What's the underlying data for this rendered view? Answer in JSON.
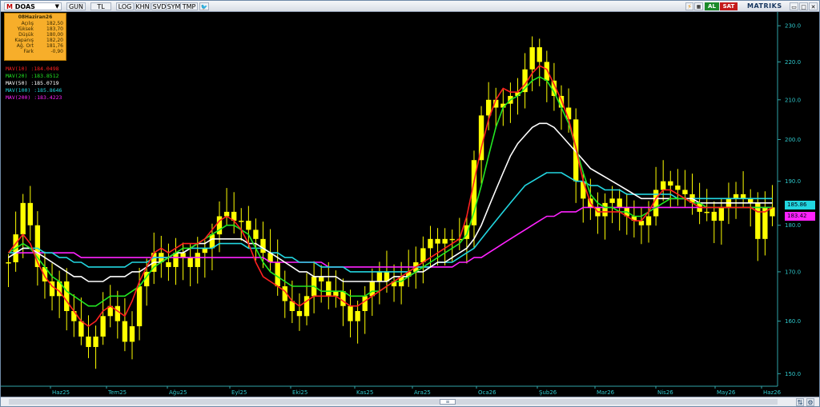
{
  "toolbar": {
    "symbol_prefix": "M",
    "symbol": "DOAS",
    "buttons": [
      "GUN",
      "TL",
      "LOG",
      "KHN",
      "SVD",
      "SYM",
      "TMP"
    ],
    "signal_buy": "AL",
    "signal_sell": "SAT",
    "brand": "MATRIKS"
  },
  "info": {
    "date": "08Haziran26",
    "rows": [
      {
        "label": "Açılış",
        "value": "182,50"
      },
      {
        "label": "Yüksek",
        "value": "183,70"
      },
      {
        "label": "Düşük",
        "value": "180,00"
      },
      {
        "label": "Kapanış",
        "value": "182,20"
      },
      {
        "label": "Ağ. Ort",
        "value": "181,76"
      },
      {
        "label": "Fark",
        "value": "-0,90"
      }
    ]
  },
  "legend": [
    {
      "name": "MAV(10)",
      "value": ":184.0498",
      "color": "#ff2020"
    },
    {
      "name": "MAV(20)",
      "value": ":183.8512",
      "color": "#22e622"
    },
    {
      "name": "MAV(50)",
      "value": ":185.0719",
      "color": "#ffffff"
    },
    {
      "name": "MAV(100)",
      "value": ":185.8646",
      "color": "#22d6e0"
    },
    {
      "name": "MAV(200)",
      "value": ":183.4223",
      "color": "#ff22ff"
    }
  ],
  "badges": [
    {
      "text": "185.86",
      "color": "#22d6e0"
    },
    {
      "text": "183.42",
      "color": "#ff22ff"
    }
  ],
  "chart_data": {
    "type": "candlestick",
    "x_ticks": [
      "Haz25",
      "Tem25",
      "Ağu25",
      "Eyl25",
      "Eki25",
      "Kas25",
      "Ara25",
      "Oca26",
      "Şub26",
      "Mar26",
      "Nis26",
      "May26",
      "Haz26"
    ],
    "y_ticks": [
      150,
      160,
      170,
      180,
      190,
      200,
      210,
      220,
      230
    ],
    "scale": "log",
    "ylim": [
      148,
      233
    ],
    "candle_color": "#ffff00",
    "closes": [
      172,
      178,
      185,
      180,
      171,
      168,
      165,
      168,
      162,
      160,
      157,
      155,
      157,
      161,
      163,
      160,
      156,
      159,
      167,
      170,
      174,
      172,
      171,
      174,
      173,
      171,
      174,
      175,
      178,
      182,
      183,
      181,
      181,
      179,
      177,
      174,
      172,
      167,
      164,
      162,
      161,
      165,
      169,
      168,
      165,
      166,
      163,
      160,
      162,
      165,
      168,
      170,
      168,
      167,
      169,
      170,
      172,
      175,
      177,
      176,
      177,
      177,
      177,
      180,
      195,
      206,
      210,
      208,
      209,
      211,
      212,
      218,
      224,
      220,
      215,
      211,
      208,
      205,
      190,
      186,
      184,
      182,
      185,
      186,
      184,
      182,
      181,
      180,
      182,
      188,
      190,
      189,
      188,
      187,
      185,
      183,
      183,
      181,
      184,
      186,
      187,
      186,
      185,
      177,
      184,
      182
    ],
    "mav": {
      "MAV(10)": [
        174,
        176,
        178,
        176,
        172,
        169,
        167,
        166,
        164,
        162,
        160,
        159,
        160,
        162,
        163,
        162,
        161,
        164,
        168,
        171,
        174,
        175,
        174,
        175,
        176,
        176,
        176,
        177,
        179,
        181,
        182,
        181,
        179,
        176,
        172,
        169,
        168,
        167,
        166,
        164,
        163,
        164,
        165,
        165,
        165,
        165,
        164,
        163,
        163,
        164,
        165,
        166,
        167,
        168,
        169,
        170,
        171,
        172,
        173,
        174,
        175,
        176,
        177,
        182,
        190,
        198,
        205,
        210,
        213,
        212,
        212,
        214,
        217,
        219,
        218,
        214,
        210,
        205,
        198,
        190,
        185,
        183,
        183,
        183,
        183,
        182,
        181,
        181,
        183,
        186,
        188,
        188,
        187,
        186,
        185,
        184,
        184,
        184,
        184,
        184,
        184,
        184,
        184,
        183,
        183,
        184
      ],
      "MAV(20)": [
        174,
        175,
        176,
        175,
        173,
        171,
        169,
        168,
        166,
        165,
        164,
        163,
        163,
        164,
        165,
        165,
        165,
        166,
        167,
        169,
        171,
        172,
        173,
        174,
        175,
        175,
        176,
        177,
        178,
        179,
        180,
        180,
        179,
        178,
        175,
        172,
        170,
        169,
        168,
        167,
        167,
        167,
        167,
        166,
        166,
        166,
        166,
        165,
        165,
        165,
        166,
        166,
        167,
        168,
        168,
        169,
        170,
        171,
        172,
        173,
        174,
        175,
        176,
        178,
        183,
        189,
        196,
        203,
        208,
        210,
        211,
        213,
        215,
        216,
        215,
        212,
        208,
        204,
        198,
        192,
        187,
        185,
        184,
        184,
        183,
        183,
        182,
        182,
        183,
        184,
        185,
        186,
        186,
        186,
        185,
        185,
        184,
        184,
        184,
        184,
        184,
        184,
        184,
        184,
        184,
        184
      ],
      "MAV(50)": [
        173,
        174,
        175,
        175,
        174,
        173,
        172,
        171,
        170,
        169,
        169,
        168,
        168,
        168,
        169,
        169,
        169,
        170,
        170,
        171,
        172,
        172,
        173,
        174,
        174,
        175,
        176,
        176,
        177,
        177,
        177,
        177,
        177,
        176,
        176,
        175,
        174,
        173,
        172,
        171,
        170,
        170,
        169,
        169,
        169,
        169,
        168,
        168,
        168,
        168,
        168,
        168,
        168,
        169,
        169,
        169,
        170,
        170,
        171,
        172,
        172,
        173,
        174,
        175,
        177,
        180,
        184,
        188,
        192,
        196,
        199,
        201,
        203,
        204,
        204,
        203,
        201,
        199,
        197,
        195,
        193,
        192,
        191,
        190,
        189,
        188,
        187,
        186,
        186,
        186,
        186,
        186,
        186,
        186,
        186,
        185,
        185,
        185,
        185,
        185,
        185,
        185,
        185,
        185,
        185,
        185
      ],
      "MAV(100)": [
        174,
        174,
        175,
        175,
        175,
        174,
        174,
        173,
        173,
        172,
        172,
        171,
        171,
        171,
        171,
        171,
        171,
        172,
        172,
        172,
        173,
        173,
        173,
        174,
        174,
        175,
        175,
        175,
        175,
        176,
        176,
        176,
        176,
        175,
        175,
        175,
        174,
        174,
        173,
        173,
        172,
        172,
        172,
        171,
        171,
        171,
        171,
        170,
        170,
        170,
        170,
        170,
        170,
        170,
        170,
        170,
        171,
        171,
        171,
        172,
        172,
        172,
        173,
        174,
        175,
        177,
        179,
        181,
        183,
        185,
        187,
        189,
        190,
        191,
        192,
        192,
        192,
        191,
        190,
        190,
        189,
        189,
        188,
        188,
        188,
        187,
        187,
        187,
        187,
        187,
        187,
        187,
        186,
        186,
        186,
        186,
        186,
        186,
        186,
        186,
        186,
        186,
        186,
        186,
        186,
        186
      ],
      "MAV(200)": [
        174,
        174,
        174,
        174,
        174,
        174,
        174,
        174,
        174,
        174,
        173,
        173,
        173,
        173,
        173,
        173,
        173,
        173,
        173,
        173,
        173,
        173,
        173,
        173,
        173,
        173,
        173,
        173,
        173,
        173,
        173,
        173,
        173,
        173,
        173,
        173,
        172,
        172,
        172,
        172,
        172,
        172,
        172,
        172,
        171,
        171,
        171,
        171,
        171,
        171,
        171,
        171,
        171,
        171,
        171,
        171,
        171,
        171,
        171,
        171,
        171,
        171,
        172,
        172,
        173,
        173,
        174,
        175,
        176,
        177,
        178,
        179,
        180,
        181,
        182,
        182,
        183,
        183,
        183,
        184,
        184,
        184,
        184,
        184,
        184,
        184,
        184,
        184,
        184,
        184,
        184,
        184,
        184,
        184,
        184,
        184,
        184,
        184,
        184,
        184,
        184,
        184,
        184,
        184,
        184,
        184
      ]
    }
  }
}
